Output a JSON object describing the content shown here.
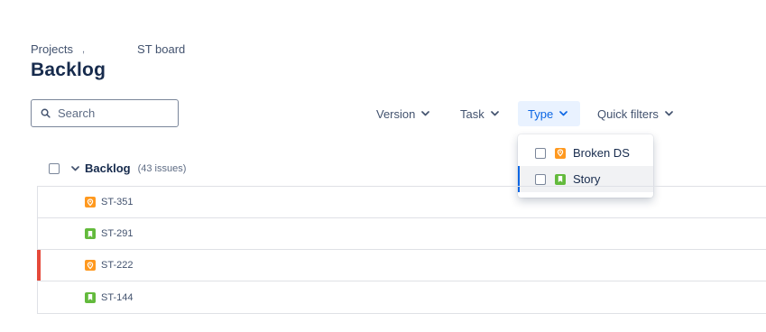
{
  "breadcrumbs": [
    {
      "label": "Projects"
    },
    {
      "label": "ST board"
    }
  ],
  "page_title": "Backlog",
  "search": {
    "placeholder": "Search",
    "value": ""
  },
  "filters": [
    {
      "label": "Version",
      "active": false
    },
    {
      "label": "Task",
      "active": false
    },
    {
      "label": "Type",
      "active": true
    },
    {
      "label": "Quick filters",
      "active": false
    }
  ],
  "type_dropdown": {
    "options": [
      {
        "label": "Broken DS",
        "icon": "bug-icon",
        "checked": false
      },
      {
        "label": "Story",
        "icon": "story-icon",
        "checked": false,
        "hovered": true
      }
    ]
  },
  "backlog": {
    "title": "Backlog",
    "count": "(43 issues)",
    "issues": [
      {
        "key": "ST-351",
        "type": "bug",
        "flagged": false
      },
      {
        "key": "ST-291",
        "type": "story",
        "flagged": false
      },
      {
        "key": "ST-222",
        "type": "bug",
        "flagged": true
      },
      {
        "key": "ST-144",
        "type": "story",
        "flagged": false
      }
    ]
  },
  "colors": {
    "accent": "#0c66e4",
    "bug": "#ff991f",
    "story": "#63ba3c",
    "flag": "#e5493a"
  }
}
